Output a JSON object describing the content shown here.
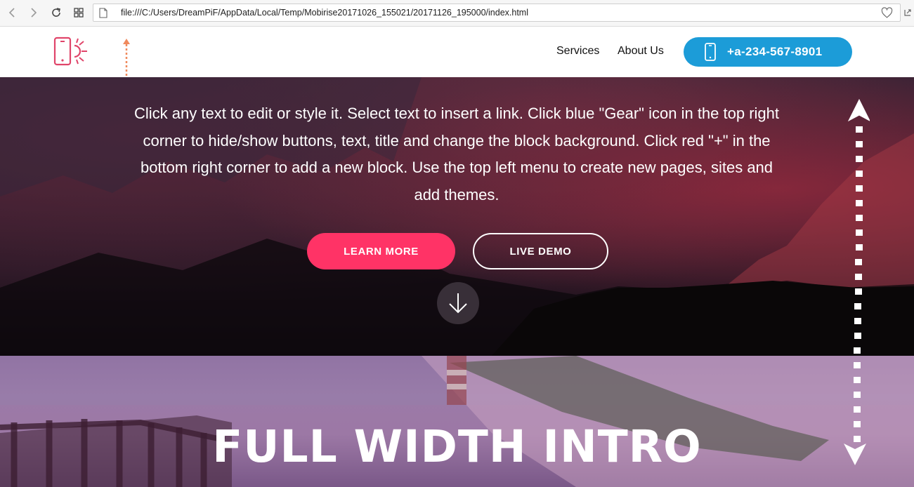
{
  "browser": {
    "url": "file:///C:/Users/DreamPiF/AppData/Local/Temp/Mobirise20171026_155021/20171126_195000/index.html"
  },
  "header": {
    "nav": [
      {
        "label": "Services"
      },
      {
        "label": "About Us"
      }
    ],
    "phone": "+a-234-567-8901"
  },
  "hero": {
    "text": "Click any text to edit or style it. Select text to insert a link. Click blue \"Gear\" icon in the top right corner to hide/show buttons, text, title and change the block background. Click red \"+\" in the bottom right corner to add a new block. Use the top left menu to create new pages, sites and add themes.",
    "primary_button": "LEARN MORE",
    "secondary_button": "LIVE DEMO"
  },
  "hero2": {
    "title": "FULL WIDTH INTRO"
  },
  "colors": {
    "accent_blue": "#1c9cd8",
    "accent_pink": "#ff3366",
    "logo": "#e0456a",
    "annotation_arrow": "#f08a5d"
  },
  "icons": [
    "back-icon",
    "forward-icon",
    "reload-icon",
    "apps-icon",
    "page-icon",
    "heart-icon",
    "phone-icon",
    "arrow-down-icon"
  ]
}
